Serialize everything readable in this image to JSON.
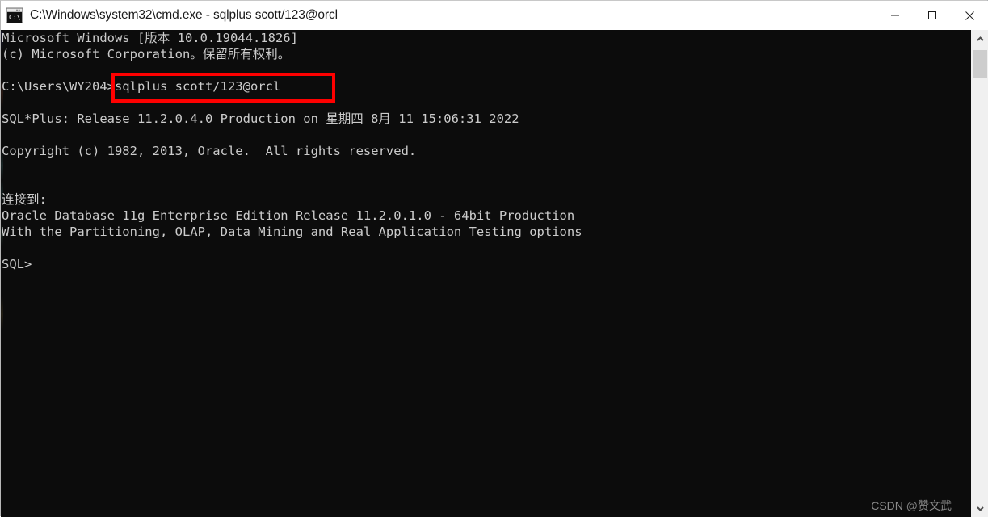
{
  "window": {
    "title": "C:\\Windows\\system32\\cmd.exe - sqlplus  scott/123@orcl",
    "icon": "cmd-console-icon",
    "background_color": "#0c0c0c",
    "text_color": "#cccccc",
    "controls": [
      {
        "name": "minimize",
        "glyph": "—"
      },
      {
        "name": "maximize",
        "glyph": "□"
      },
      {
        "name": "close",
        "glyph": "✕"
      }
    ]
  },
  "terminal": {
    "lines": [
      "Microsoft Windows [版本 10.0.19044.1826]",
      "(c) Microsoft Corporation。保留所有权利。",
      "",
      "C:\\Users\\WY204>sqlplus scott/123@orcl",
      "",
      "SQL*Plus: Release 11.2.0.4.0 Production on 星期四 8月 11 15:06:31 2022",
      "",
      "Copyright (c) 1982, 2013, Oracle.  All rights reserved.",
      "",
      "",
      "连接到:",
      "Oracle Database 11g Enterprise Edition Release 11.2.0.1.0 - 64bit Production",
      "With the Partitioning, OLAP, Data Mining and Real Application Testing options",
      "",
      "SQL>"
    ],
    "command": "sqlplus scott/123@orcl",
    "prompt": "C:\\Users\\WY204>",
    "sql_prompt": "SQL>"
  },
  "annotation": {
    "color": "#ff0000",
    "target_text": ">sqlplus scott/123@orcl"
  },
  "watermark": {
    "text": "CSDN @赞文武"
  },
  "scrollbar": {
    "up_arrow": "chevron-up",
    "down_arrow": "chevron-down",
    "track_color": "#f0f0f0",
    "thumb_color": "#cdcdcd"
  }
}
